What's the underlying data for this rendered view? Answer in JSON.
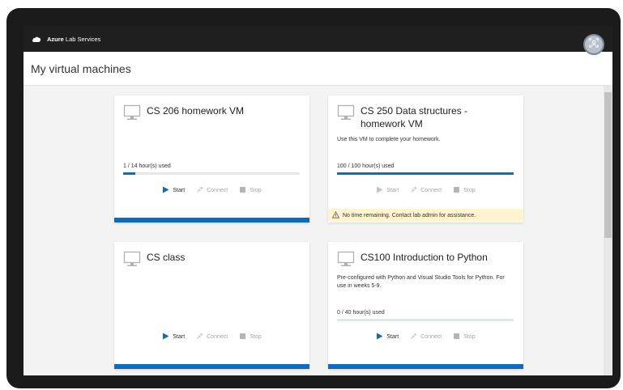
{
  "app": {
    "brand_bold": "Azure",
    "brand_rest": " Lab Services"
  },
  "header": {
    "title": "My virtual machines"
  },
  "actions": {
    "start": "Start",
    "connect": "Connect",
    "stop": "Stop"
  },
  "colors": {
    "accent": "#0f6cbd",
    "topbar": "#1f1f1f",
    "warning_bg": "#fff4ce"
  },
  "cards": [
    {
      "title": "CS 206 homework VM",
      "description": "",
      "usage": "1 / 14 hour(s) used",
      "usage_fraction": 0.071,
      "start_enabled": true,
      "warning": ""
    },
    {
      "title": "CS 250 Data structures - homework VM",
      "description": "Use this VM to complete your homework.",
      "usage": "100  / 100 hour(s) used",
      "usage_fraction": 1.0,
      "start_enabled": false,
      "warning": "No time remaining. Contact lab admin for assistance."
    },
    {
      "title": "CS class",
      "description": "",
      "usage": "",
      "usage_fraction": null,
      "start_enabled": true,
      "warning": ""
    },
    {
      "title": "CS100 Introduction to Python",
      "description": "Pre-configured with Python and Visual Studio Tools for Python. For use in weeks 5-9.",
      "usage": "0 / 40 hour(s) used",
      "usage_fraction": 0.0,
      "start_enabled": true,
      "warning": ""
    }
  ]
}
